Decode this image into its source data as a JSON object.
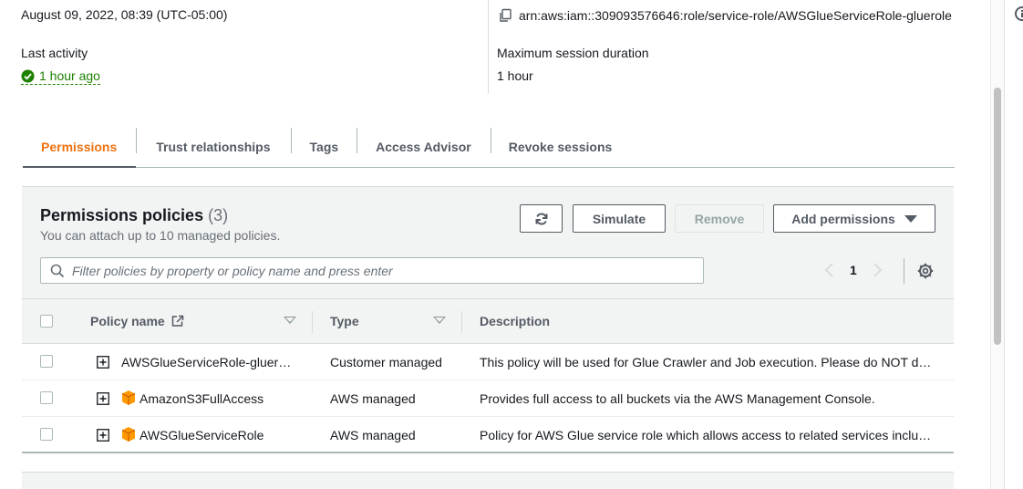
{
  "summary": {
    "created_date": "August 09, 2022, 08:39 (UTC-05:00)",
    "arn": "arn:aws:iam::309093576646:role/service-role/AWSGlueServiceRole-gluerole",
    "last_activity_label": "Last activity",
    "last_activity_value": "1 hour ago",
    "max_session_label": "Maximum session duration",
    "max_session_value": "1 hour"
  },
  "tabs": [
    {
      "label": "Permissions",
      "active": true
    },
    {
      "label": "Trust relationships",
      "active": false
    },
    {
      "label": "Tags",
      "active": false
    },
    {
      "label": "Access Advisor",
      "active": false
    },
    {
      "label": "Revoke sessions",
      "active": false
    }
  ],
  "panel": {
    "title": "Permissions policies",
    "count": "(3)",
    "subtitle": "You can attach up to 10 managed policies.",
    "buttons": {
      "refresh_icon": "refresh-icon",
      "simulate": "Simulate",
      "remove": "Remove",
      "add_permissions": "Add permissions"
    },
    "search_placeholder": "Filter policies by property or policy name and press enter",
    "page_number": "1"
  },
  "table": {
    "columns": [
      "Policy name",
      "Type",
      "Description"
    ],
    "rows": [
      {
        "policy_name": "AWSGlueServiceRole-gluer…",
        "type": "Customer managed",
        "description": "This policy will be used for Glue Crawler and Job execution. Please do NOT d…",
        "aws_managed_icon": false
      },
      {
        "policy_name": "AmazonS3FullAccess",
        "type": "AWS managed",
        "description": "Provides full access to all buckets via the AWS Management Console.",
        "aws_managed_icon": true
      },
      {
        "policy_name": "AWSGlueServiceRole",
        "type": "AWS managed",
        "description": "Policy for AWS Glue service role which allows access to related services inclu…",
        "aws_managed_icon": true
      }
    ]
  },
  "colors": {
    "active_tab": "#ec7211",
    "link": "#0073bb",
    "success": "#1d8102",
    "aws_box": "#f90"
  }
}
